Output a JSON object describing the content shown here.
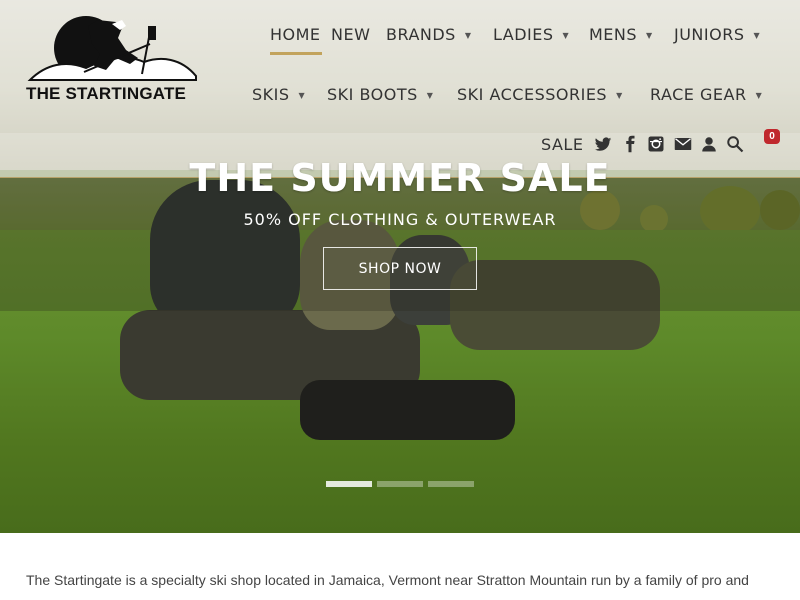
{
  "site": {
    "logo_text": "THE STARTINGATE"
  },
  "nav": {
    "row1": [
      {
        "label": "HOME",
        "caret": false,
        "active": true
      },
      {
        "label": "NEW",
        "caret": false
      },
      {
        "label": "BRANDS",
        "caret": true
      },
      {
        "label": "LADIES",
        "caret": true
      },
      {
        "label": "MENS",
        "caret": true
      },
      {
        "label": "JUNIORS",
        "caret": true
      }
    ],
    "row2": [
      {
        "label": "SKIS",
        "caret": true
      },
      {
        "label": "SKI BOOTS",
        "caret": true
      },
      {
        "label": "SKI ACCESSORIES",
        "caret": true
      },
      {
        "label": "RACE GEAR",
        "caret": true
      }
    ],
    "caret_glyph": "▼",
    "sale": "SALE"
  },
  "utility_icons": [
    "twitter-icon",
    "facebook-icon",
    "instagram-icon",
    "email-icon",
    "account-icon",
    "search-icon",
    "cart-icon"
  ],
  "cart": {
    "count": "0",
    "badge_color": "#c0282d"
  },
  "hero": {
    "title": "THE SUMMER SALE",
    "subtitle": "50% OFF CLOTHING & OUTERWEAR",
    "button": "SHOP NOW",
    "slides": 3,
    "active_slide": 1
  },
  "intro": {
    "text": "The Startingate is a specialty ski shop located in Jamaica, Vermont near Stratton Mountain run by a family of pro and"
  },
  "colors": {
    "accent": "#c2a35c",
    "nav_text": "#333333",
    "hero_text": "#ffffff"
  }
}
